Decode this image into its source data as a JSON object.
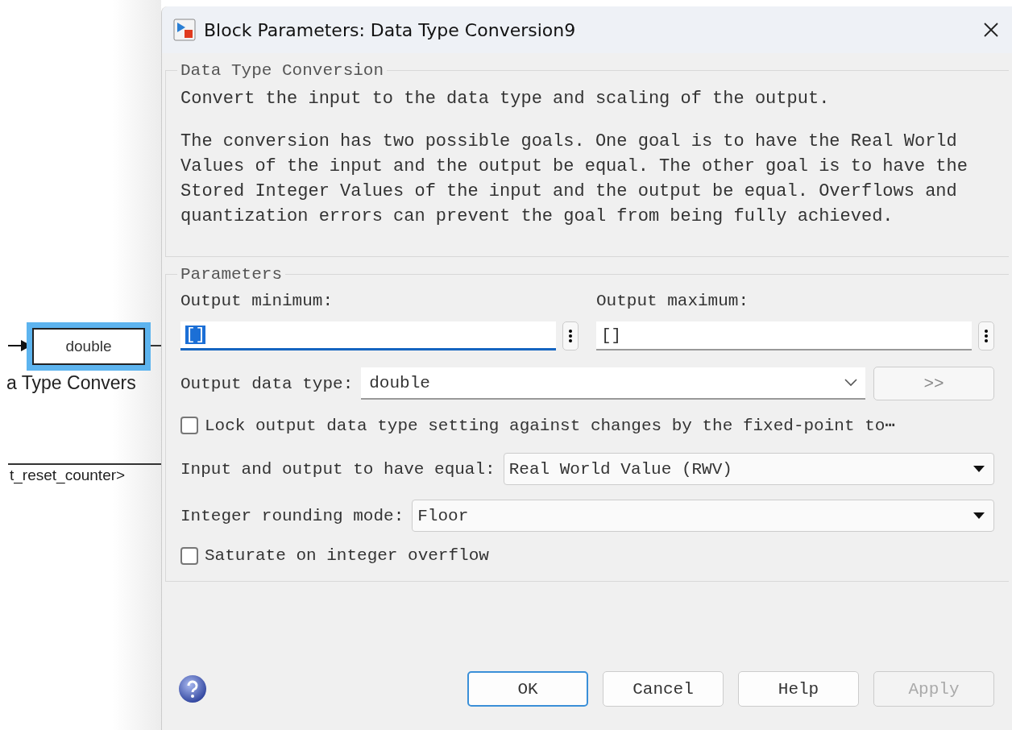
{
  "canvas": {
    "block": {
      "label": "double",
      "selected": true
    },
    "block_caption": "a Type Convers",
    "signal_label": "t_reset_counter>"
  },
  "window": {
    "title": "Block Parameters: Data Type Conversion9"
  },
  "description": {
    "title": "Data Type Conversion",
    "paragraphs": [
      "Convert the input to the data type and scaling of the output.",
      "The conversion has two possible goals. One goal is to have the Real World Values of the input and the output be equal.  The other goal is to have the Stored Integer Values of the input and the output be equal.  Overflows and quantization errors can prevent the goal from being fully achieved."
    ]
  },
  "parameters": {
    "title": "Parameters",
    "range_fields": [
      {
        "label": "Output minimum:",
        "value": "[]",
        "focused": true
      },
      {
        "label": "Output maximum:",
        "value": "[]",
        "focused": false
      }
    ],
    "data_type": {
      "label": "Output data type:",
      "value": "double",
      "assistant_button": ">>"
    },
    "lock": {
      "label": "Lock output data type setting against changes by the fixed-point to⋯",
      "checked": false
    },
    "dropdowns": [
      {
        "label": "Input and output to have equal:",
        "value": "Real World Value (RWV)"
      },
      {
        "label": "Integer rounding mode:",
        "value": "Floor"
      }
    ],
    "saturate": {
      "label": "Saturate on integer overflow",
      "checked": false
    }
  },
  "buttons": [
    {
      "label": "OK",
      "default": true,
      "disabled": false
    },
    {
      "label": "Cancel",
      "default": false,
      "disabled": false
    },
    {
      "label": "Help",
      "default": false,
      "disabled": false
    },
    {
      "label": "Apply",
      "default": false,
      "disabled": true
    }
  ]
}
